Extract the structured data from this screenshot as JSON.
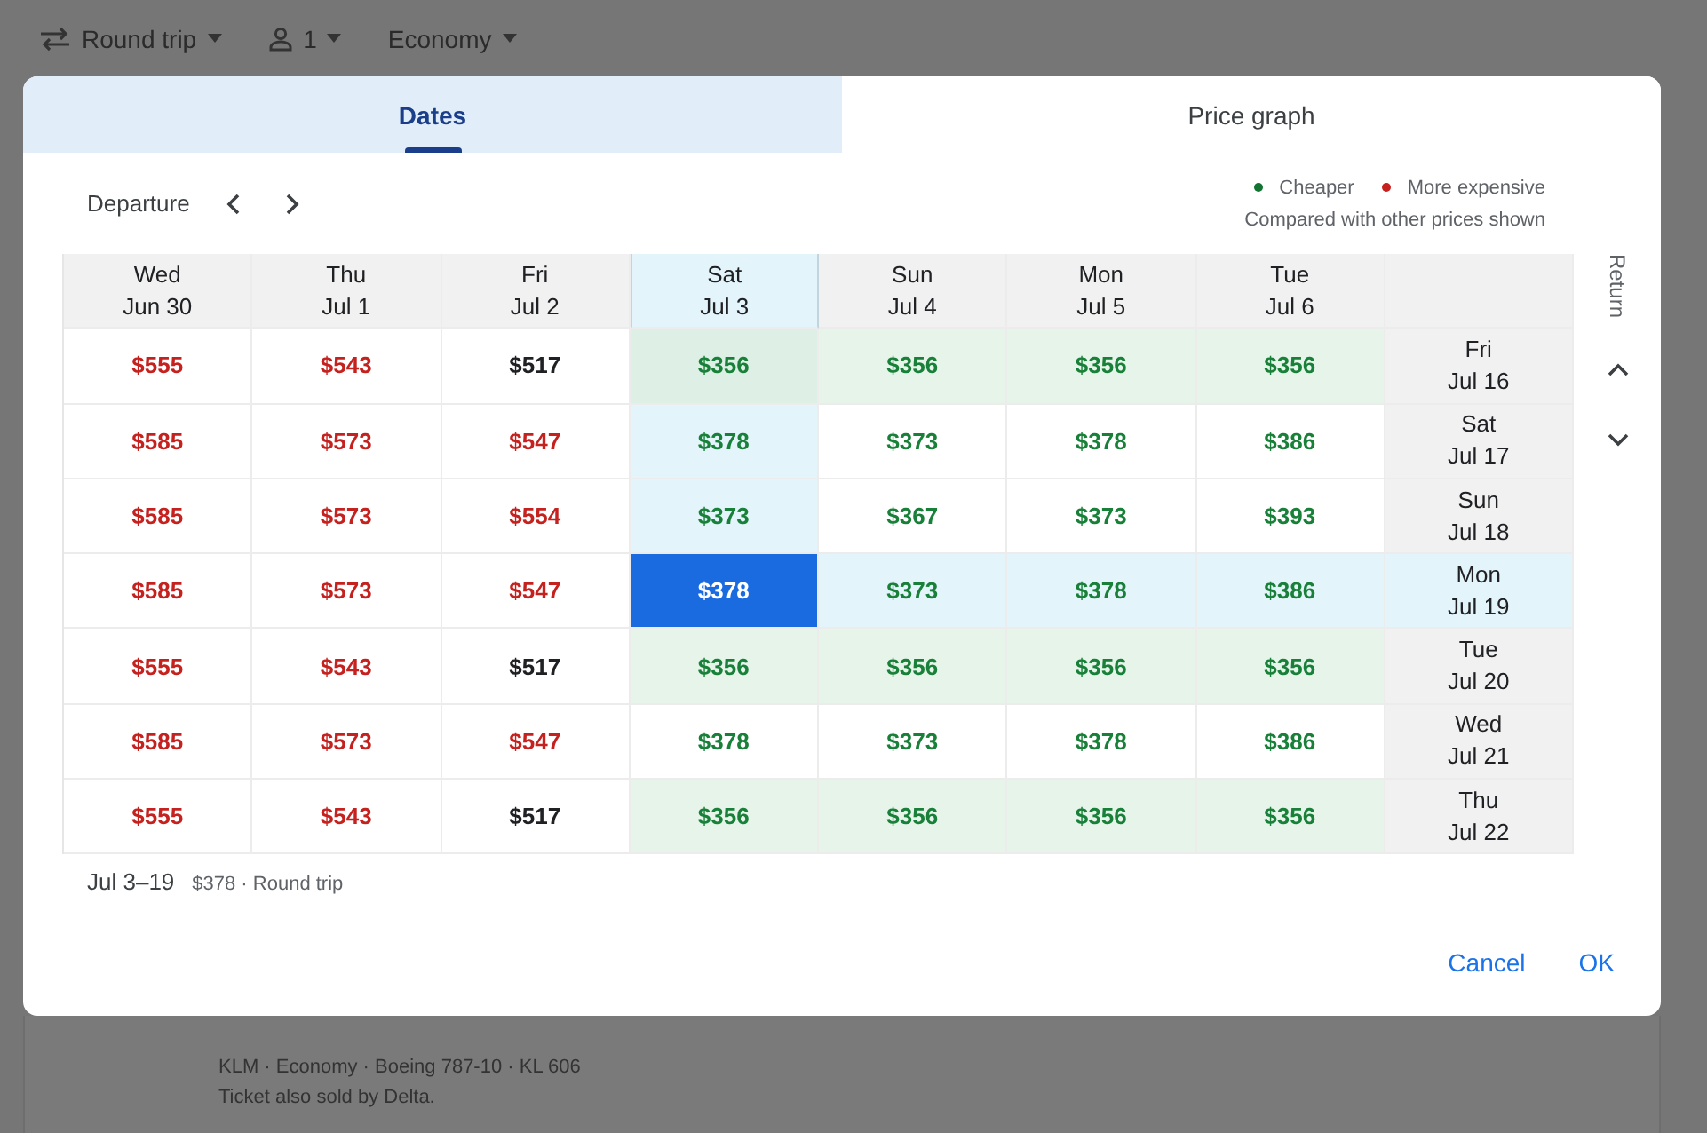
{
  "top_bar": {
    "trip_type": "Round trip",
    "passengers": "1",
    "cabin": "Economy"
  },
  "tabs": [
    {
      "label": "Dates",
      "selected": true
    },
    {
      "label": "Price graph",
      "selected": false
    }
  ],
  "departure_nav": {
    "label": "Departure"
  },
  "legend": {
    "items": [
      {
        "label": "Cheaper",
        "color": "#137333"
      },
      {
        "label": "More expensive",
        "color": "#c5221f"
      }
    ],
    "note": "Compared with other prices shown"
  },
  "return_label": "Return",
  "departures": [
    {
      "day": "Wed",
      "date": "Jun 30",
      "selected": false
    },
    {
      "day": "Thu",
      "date": "Jul 1",
      "selected": false
    },
    {
      "day": "Fri",
      "date": "Jul 2",
      "selected": false
    },
    {
      "day": "Sat",
      "date": "Jul 3",
      "selected": true
    },
    {
      "day": "Sun",
      "date": "Jul 4",
      "selected": false
    },
    {
      "day": "Mon",
      "date": "Jul 5",
      "selected": false
    },
    {
      "day": "Tue",
      "date": "Jul 6",
      "selected": false
    }
  ],
  "returns": [
    {
      "day": "Fri",
      "date": "Jul 16",
      "selected": false
    },
    {
      "day": "Sat",
      "date": "Jul 17",
      "selected": false
    },
    {
      "day": "Sun",
      "date": "Jul 18",
      "selected": false
    },
    {
      "day": "Mon",
      "date": "Jul 19",
      "selected": true
    },
    {
      "day": "Tue",
      "date": "Jul 20",
      "selected": false
    },
    {
      "day": "Wed",
      "date": "Jul 21",
      "selected": false
    },
    {
      "day": "Thu",
      "date": "Jul 22",
      "selected": false
    }
  ],
  "rows": [
    {
      "cells": [
        {
          "price": "$555",
          "kind": "expensive",
          "lowest": false,
          "selected": false
        },
        {
          "price": "$543",
          "kind": "expensive",
          "lowest": false,
          "selected": false
        },
        {
          "price": "$517",
          "kind": "regular",
          "lowest": false,
          "selected": false
        },
        {
          "price": "$356",
          "kind": "cheap",
          "lowest": true,
          "selected": false
        },
        {
          "price": "$356",
          "kind": "cheap",
          "lowest": true,
          "selected": false
        },
        {
          "price": "$356",
          "kind": "cheap",
          "lowest": true,
          "selected": false
        },
        {
          "price": "$356",
          "kind": "cheap",
          "lowest": true,
          "selected": false
        }
      ]
    },
    {
      "cells": [
        {
          "price": "$585",
          "kind": "expensive",
          "lowest": false,
          "selected": false
        },
        {
          "price": "$573",
          "kind": "expensive",
          "lowest": false,
          "selected": false
        },
        {
          "price": "$547",
          "kind": "expensive",
          "lowest": false,
          "selected": false
        },
        {
          "price": "$378",
          "kind": "cheap",
          "lowest": false,
          "selected": false
        },
        {
          "price": "$373",
          "kind": "cheap",
          "lowest": false,
          "selected": false
        },
        {
          "price": "$378",
          "kind": "cheap",
          "lowest": false,
          "selected": false
        },
        {
          "price": "$386",
          "kind": "cheap",
          "lowest": false,
          "selected": false
        }
      ]
    },
    {
      "cells": [
        {
          "price": "$585",
          "kind": "expensive",
          "lowest": false,
          "selected": false
        },
        {
          "price": "$573",
          "kind": "expensive",
          "lowest": false,
          "selected": false
        },
        {
          "price": "$554",
          "kind": "expensive",
          "lowest": false,
          "selected": false
        },
        {
          "price": "$373",
          "kind": "cheap",
          "lowest": false,
          "selected": false
        },
        {
          "price": "$367",
          "kind": "cheap",
          "lowest": false,
          "selected": false
        },
        {
          "price": "$373",
          "kind": "cheap",
          "lowest": false,
          "selected": false
        },
        {
          "price": "$393",
          "kind": "cheap",
          "lowest": false,
          "selected": false
        }
      ]
    },
    {
      "cells": [
        {
          "price": "$585",
          "kind": "expensive",
          "lowest": false,
          "selected": false
        },
        {
          "price": "$573",
          "kind": "expensive",
          "lowest": false,
          "selected": false
        },
        {
          "price": "$547",
          "kind": "expensive",
          "lowest": false,
          "selected": false
        },
        {
          "price": "$378",
          "selected": true
        },
        {
          "price": "$373",
          "kind": "cheap",
          "lowest": false,
          "selected": false
        },
        {
          "price": "$378",
          "kind": "cheap",
          "lowest": false,
          "selected": false
        },
        {
          "price": "$386",
          "kind": "cheap",
          "lowest": false,
          "selected": false
        }
      ]
    },
    {
      "cells": [
        {
          "price": "$555",
          "kind": "expensive",
          "lowest": false,
          "selected": false
        },
        {
          "price": "$543",
          "kind": "expensive",
          "lowest": false,
          "selected": false
        },
        {
          "price": "$517",
          "kind": "regular",
          "lowest": false,
          "selected": false
        },
        {
          "price": "$356",
          "kind": "cheap",
          "lowest": true,
          "selected": false
        },
        {
          "price": "$356",
          "kind": "cheap",
          "lowest": true,
          "selected": false
        },
        {
          "price": "$356",
          "kind": "cheap",
          "lowest": true,
          "selected": false
        },
        {
          "price": "$356",
          "kind": "cheap",
          "lowest": true,
          "selected": false
        }
      ]
    },
    {
      "cells": [
        {
          "price": "$585",
          "kind": "expensive",
          "lowest": false,
          "selected": false
        },
        {
          "price": "$573",
          "kind": "expensive",
          "lowest": false,
          "selected": false
        },
        {
          "price": "$547",
          "kind": "expensive",
          "lowest": false,
          "selected": false
        },
        {
          "price": "$378",
          "kind": "cheap",
          "lowest": false,
          "selected": false
        },
        {
          "price": "$373",
          "kind": "cheap",
          "lowest": false,
          "selected": false
        },
        {
          "price": "$378",
          "kind": "cheap",
          "lowest": false,
          "selected": false
        },
        {
          "price": "$386",
          "kind": "cheap",
          "lowest": false,
          "selected": false
        }
      ]
    },
    {
      "cells": [
        {
          "price": "$555",
          "kind": "expensive",
          "lowest": false,
          "selected": false
        },
        {
          "price": "$543",
          "kind": "expensive",
          "lowest": false,
          "selected": false
        },
        {
          "price": "$517",
          "kind": "regular",
          "lowest": false,
          "selected": false
        },
        {
          "price": "$356",
          "kind": "cheap",
          "lowest": true,
          "selected": false
        },
        {
          "price": "$356",
          "kind": "cheap",
          "lowest": true,
          "selected": false
        },
        {
          "price": "$356",
          "kind": "cheap",
          "lowest": true,
          "selected": false
        },
        {
          "price": "$356",
          "kind": "cheap",
          "lowest": true,
          "selected": false
        }
      ]
    }
  ],
  "summary": {
    "dates": "Jul 3–19",
    "price": "$378 · Round trip"
  },
  "buttons": [
    {
      "label": "Cancel"
    },
    {
      "label": "OK"
    }
  ],
  "background_flight": {
    "details": "KLM · Economy · Boeing 787-10 · KL 606",
    "note": "Ticket also sold by Delta."
  }
}
